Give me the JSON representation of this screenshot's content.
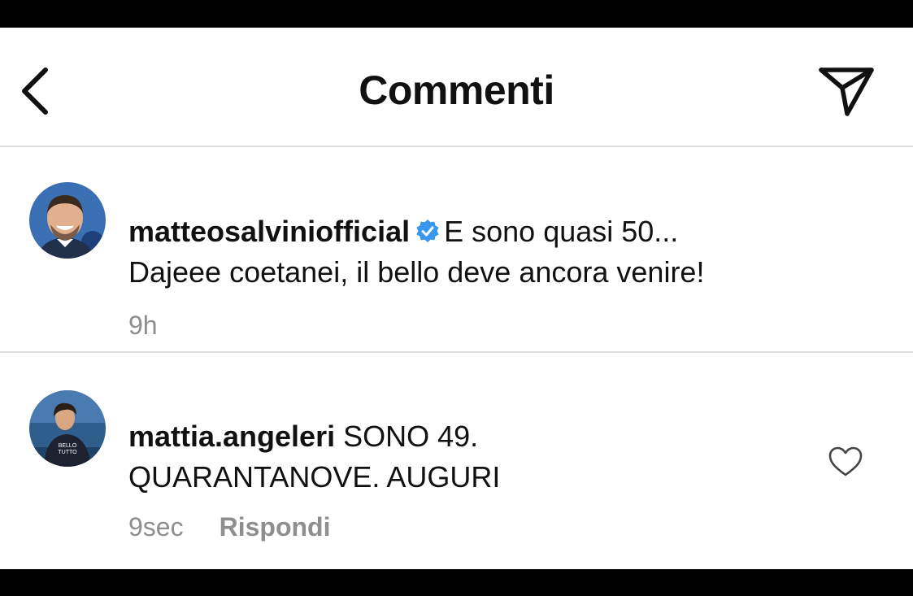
{
  "header": {
    "title": "Commenti"
  },
  "comments": [
    {
      "username": "matteosalviniofficial",
      "verified": true,
      "text_line1": "E sono quasi 50...",
      "text_line2": "Dajeee coetanei, il bello deve ancora venire!",
      "time": "9h"
    },
    {
      "username": "mattia.angeleri",
      "verified": false,
      "text_line1": "SONO 49.",
      "text_line2": "QUARANTANOVE. AUGURI",
      "time": "9sec",
      "reply_label": "Rispondi"
    }
  ],
  "colors": {
    "verified_badge": "#3897f0",
    "secondary_text": "#8e8e8e",
    "primary_text": "#111111",
    "divider": "#dcdcdc"
  },
  "icons": [
    "back-chevron-icon",
    "direct-share-icon",
    "verified-badge-icon",
    "heart-icon"
  ]
}
